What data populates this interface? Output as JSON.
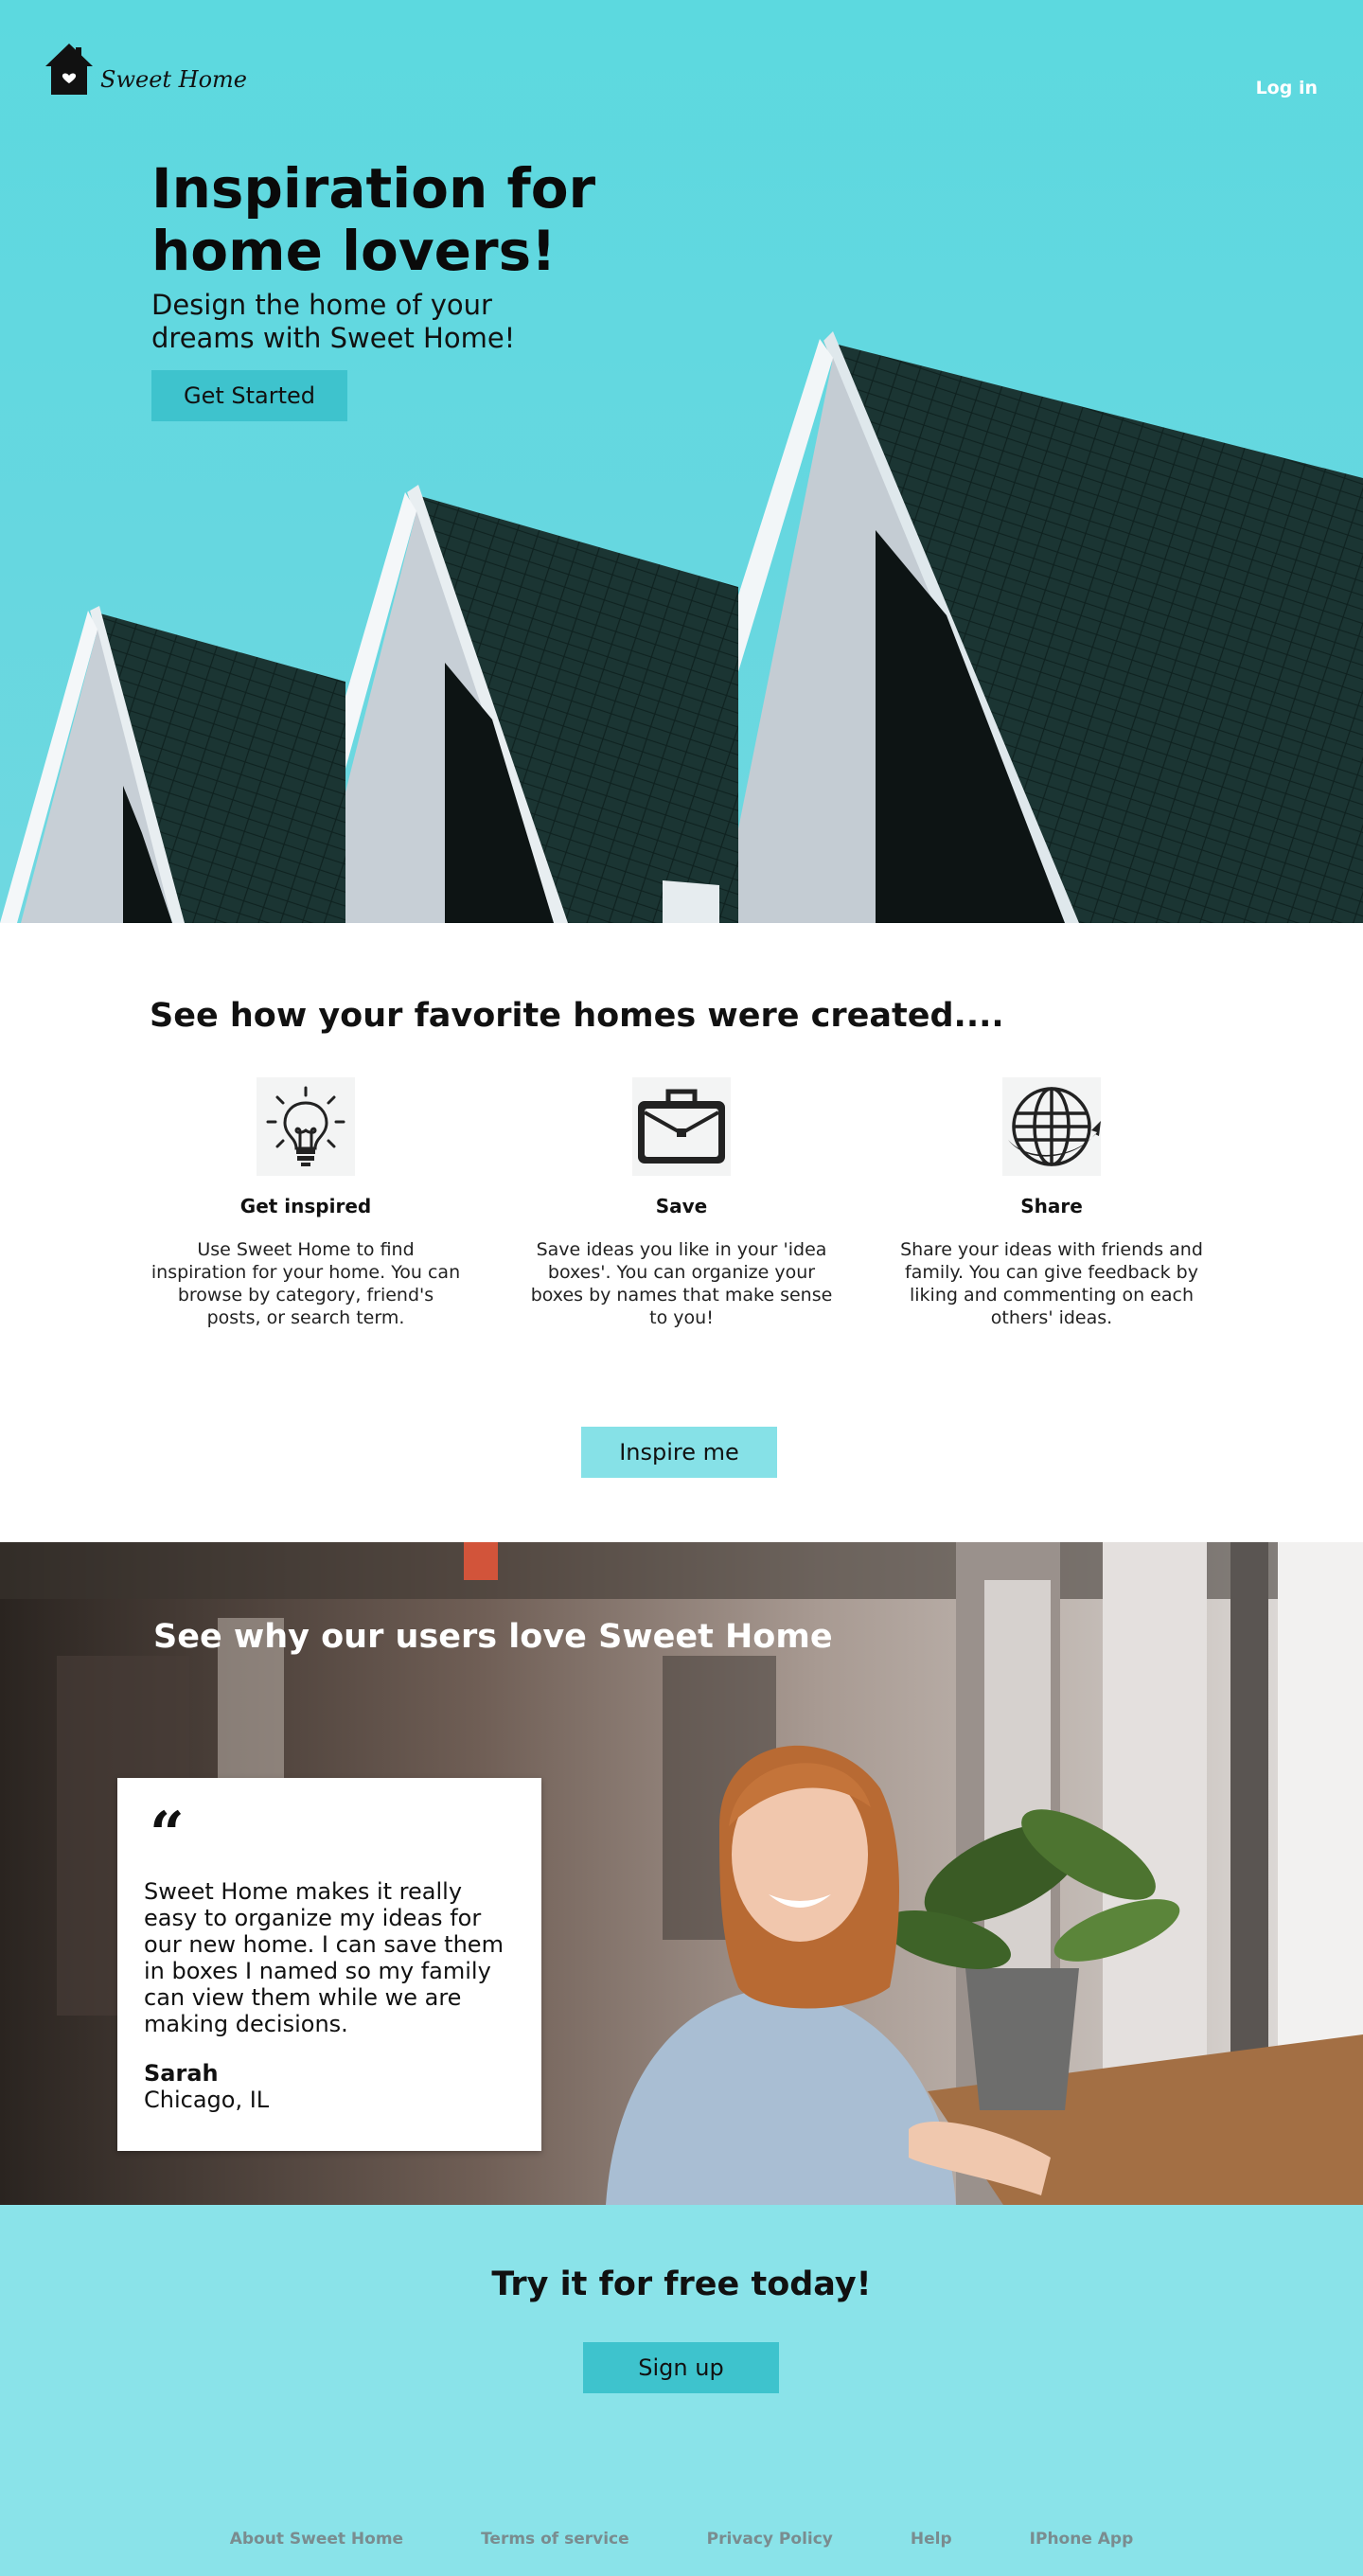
{
  "brand": {
    "name": "Sweet Home"
  },
  "nav": {
    "login_label": "Log in"
  },
  "hero": {
    "title": "Inspiration for home lovers!",
    "subtitle": "Design the home of your dreams with Sweet Home!",
    "cta_label": "Get Started"
  },
  "features": {
    "title": "See how your favorite homes were created....",
    "items": [
      {
        "icon": "lightbulb-icon",
        "title": "Get inspired",
        "desc": "Use Sweet Home to find inspiration for your home.  You can browse by category, friend's posts, or search term."
      },
      {
        "icon": "briefcase-icon",
        "title": "Save",
        "desc": "Save ideas you like in your 'idea boxes'.  You can organize your boxes by names that make sense to you!"
      },
      {
        "icon": "globe-icon",
        "title": "Share",
        "desc": "Share your ideas with friends and family.  You can give feedback by liking and commenting on each others' ideas."
      }
    ],
    "cta_label": "Inspire me"
  },
  "testimonial": {
    "title": "See why our users love Sweet Home",
    "quote_mark": "“",
    "quote": "Sweet Home makes it really easy to organize my ideas for our new home.  I can save them in boxes I named so my family can view them while we are making decisions.",
    "name": "Sarah",
    "location": "Chicago, IL"
  },
  "cta": {
    "title": "Try it for free today!",
    "button_label": "Sign up"
  },
  "footer": {
    "links": [
      "About Sweet Home",
      "Terms of service",
      "Privacy Policy",
      "Help",
      "IPhone App"
    ]
  },
  "colors": {
    "hero_bg": "#5cd9df",
    "button_dark": "#3ec3cd",
    "button_light": "#86e1e7",
    "cta_bg": "#8ae3e9"
  }
}
